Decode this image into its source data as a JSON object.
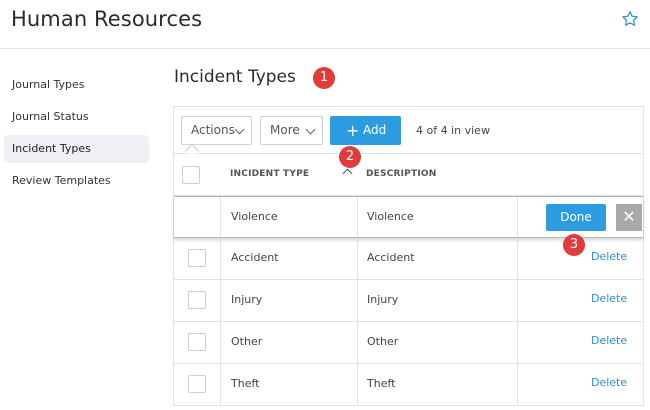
{
  "header": {
    "title": "Human Resources",
    "favorite_icon": "star-icon"
  },
  "sidebar": {
    "items": [
      {
        "label": "Journal Types",
        "active": false
      },
      {
        "label": "Journal Status",
        "active": false
      },
      {
        "label": "Incident Types",
        "active": true
      },
      {
        "label": "Review Templates",
        "active": false
      }
    ]
  },
  "main": {
    "title": "Incident Types",
    "toolbar": {
      "actions_label": "Actions",
      "more_label": "More",
      "add_label": "Add",
      "count_text": "4 of 4 in view"
    },
    "table": {
      "columns": [
        "INCIDENT TYPE",
        "DESCRIPTION"
      ],
      "sort_column": "INCIDENT TYPE",
      "sort_direction": "ascending",
      "editing_row": {
        "incident_type": "Violence",
        "description": "Violence",
        "done_label": "Done",
        "cancel_label": "✕"
      },
      "rows": [
        {
          "incident_type": "Accident",
          "description": "Accident",
          "action": "Delete"
        },
        {
          "incident_type": "Injury",
          "description": "Injury",
          "action": "Delete"
        },
        {
          "incident_type": "Other",
          "description": "Other",
          "action": "Delete"
        },
        {
          "incident_type": "Theft",
          "description": "Theft",
          "action": "Delete"
        }
      ]
    }
  },
  "callouts": [
    "1",
    "2",
    "3"
  ],
  "colors": {
    "accent": "#2d9be0",
    "callout": "#e03c3c",
    "link": "#2d8fd5"
  }
}
